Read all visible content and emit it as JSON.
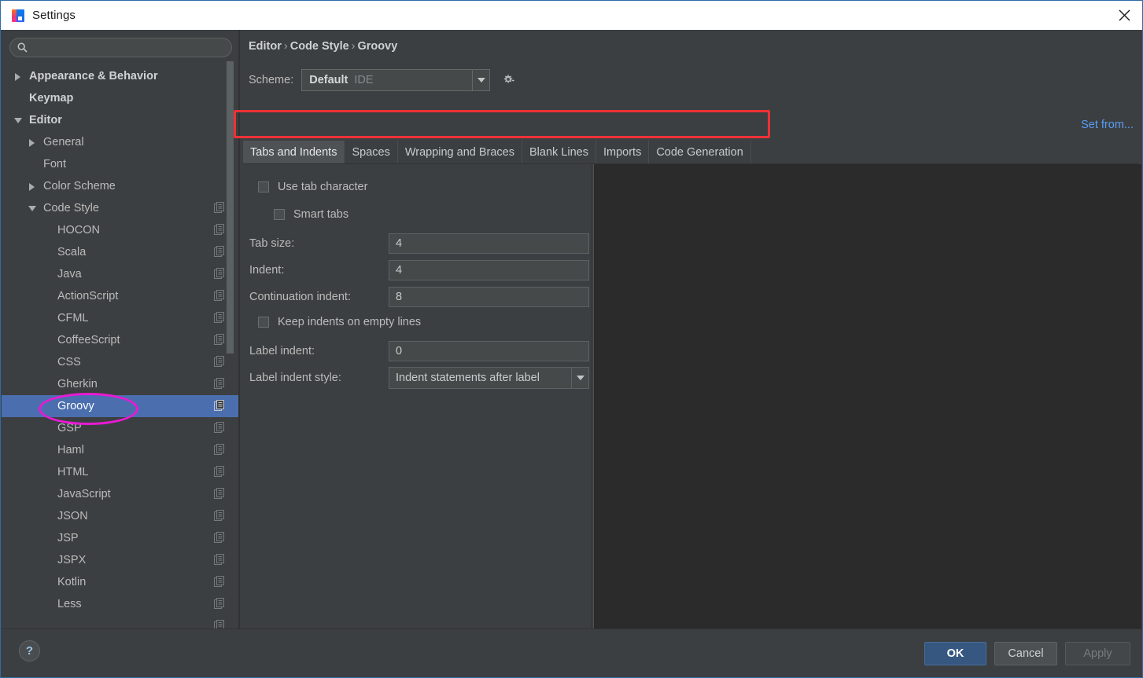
{
  "window": {
    "title": "Settings",
    "app_icon": "intellij-idea-icon",
    "close_icon": "close-icon"
  },
  "colors": {
    "accent_blue": "#4b6eaf",
    "link_blue": "#589df6",
    "primary_button": "#365880",
    "panel_bg": "#3c3f41",
    "preview_bg": "#2b2b2b",
    "annotation_red": "#ec3237",
    "annotation_magenta": "#e81ad4"
  },
  "sidebar": {
    "search": {
      "value": "",
      "placeholder": "",
      "icon": "search-icon"
    },
    "items": [
      {
        "label": "Appearance & Behavior",
        "indent": 0,
        "twisty": "collapsed",
        "bold": true,
        "selected": false,
        "copy_icon": false
      },
      {
        "label": "Keymap",
        "indent": 0,
        "twisty": "none",
        "bold": true,
        "selected": false,
        "copy_icon": false
      },
      {
        "label": "Editor",
        "indent": 0,
        "twisty": "expanded",
        "bold": true,
        "selected": false,
        "copy_icon": false
      },
      {
        "label": "General",
        "indent": 1,
        "twisty": "collapsed",
        "bold": false,
        "selected": false,
        "copy_icon": false
      },
      {
        "label": "Font",
        "indent": 1,
        "twisty": "none",
        "bold": false,
        "selected": false,
        "copy_icon": false
      },
      {
        "label": "Color Scheme",
        "indent": 1,
        "twisty": "collapsed",
        "bold": false,
        "selected": false,
        "copy_icon": false
      },
      {
        "label": "Code Style",
        "indent": 1,
        "twisty": "expanded",
        "bold": false,
        "selected": false,
        "copy_icon": true
      },
      {
        "label": "HOCON",
        "indent": 2,
        "twisty": "none",
        "bold": false,
        "selected": false,
        "copy_icon": true
      },
      {
        "label": "Scala",
        "indent": 2,
        "twisty": "none",
        "bold": false,
        "selected": false,
        "copy_icon": true
      },
      {
        "label": "Java",
        "indent": 2,
        "twisty": "none",
        "bold": false,
        "selected": false,
        "copy_icon": true
      },
      {
        "label": "ActionScript",
        "indent": 2,
        "twisty": "none",
        "bold": false,
        "selected": false,
        "copy_icon": true
      },
      {
        "label": "CFML",
        "indent": 2,
        "twisty": "none",
        "bold": false,
        "selected": false,
        "copy_icon": true
      },
      {
        "label": "CoffeeScript",
        "indent": 2,
        "twisty": "none",
        "bold": false,
        "selected": false,
        "copy_icon": true
      },
      {
        "label": "CSS",
        "indent": 2,
        "twisty": "none",
        "bold": false,
        "selected": false,
        "copy_icon": true
      },
      {
        "label": "Gherkin",
        "indent": 2,
        "twisty": "none",
        "bold": false,
        "selected": false,
        "copy_icon": true
      },
      {
        "label": "Groovy",
        "indent": 2,
        "twisty": "none",
        "bold": false,
        "selected": true,
        "copy_icon": true
      },
      {
        "label": "GSP",
        "indent": 2,
        "twisty": "none",
        "bold": false,
        "selected": false,
        "copy_icon": true
      },
      {
        "label": "Haml",
        "indent": 2,
        "twisty": "none",
        "bold": false,
        "selected": false,
        "copy_icon": true
      },
      {
        "label": "HTML",
        "indent": 2,
        "twisty": "none",
        "bold": false,
        "selected": false,
        "copy_icon": true
      },
      {
        "label": "JavaScript",
        "indent": 2,
        "twisty": "none",
        "bold": false,
        "selected": false,
        "copy_icon": true
      },
      {
        "label": "JSON",
        "indent": 2,
        "twisty": "none",
        "bold": false,
        "selected": false,
        "copy_icon": true
      },
      {
        "label": "JSP",
        "indent": 2,
        "twisty": "none",
        "bold": false,
        "selected": false,
        "copy_icon": true
      },
      {
        "label": "JSPX",
        "indent": 2,
        "twisty": "none",
        "bold": false,
        "selected": false,
        "copy_icon": true
      },
      {
        "label": "Kotlin",
        "indent": 2,
        "twisty": "none",
        "bold": false,
        "selected": false,
        "copy_icon": true
      },
      {
        "label": "Less",
        "indent": 2,
        "twisty": "none",
        "bold": false,
        "selected": false,
        "copy_icon": true
      },
      {
        "label": "",
        "indent": 2,
        "twisty": "none",
        "bold": false,
        "selected": false,
        "copy_icon": true
      }
    ]
  },
  "main": {
    "breadcrumb": {
      "parts": [
        "Editor",
        "Code Style",
        "Groovy"
      ],
      "separator": "›"
    },
    "scheme": {
      "label": "Scheme:",
      "value": "Default",
      "sub_value": "IDE",
      "gear_icon": "gear-dropdown-icon",
      "arrow_icon": "chevron-down-icon"
    },
    "set_from_link": "Set from...",
    "tabs": [
      {
        "label": "Tabs and Indents",
        "active": true
      },
      {
        "label": "Spaces",
        "active": false
      },
      {
        "label": "Wrapping and Braces",
        "active": false
      },
      {
        "label": "Blank Lines",
        "active": false
      },
      {
        "label": "Imports",
        "active": false
      },
      {
        "label": "Code Generation",
        "active": false
      }
    ],
    "form": {
      "use_tab_character": {
        "label": "Use tab character",
        "checked": false
      },
      "smart_tabs": {
        "label": "Smart tabs",
        "checked": false
      },
      "tab_size": {
        "label": "Tab size:",
        "value": "4"
      },
      "indent": {
        "label": "Indent:",
        "value": "4"
      },
      "continuation_indent": {
        "label": "Continuation indent:",
        "value": "8"
      },
      "keep_indents_empty_lines": {
        "label": "Keep indents on empty lines",
        "checked": false
      },
      "label_indent": {
        "label": "Label indent:",
        "value": "0"
      },
      "label_indent_style": {
        "label": "Label indent style:",
        "value": "Indent statements after label"
      }
    }
  },
  "footer": {
    "help_label": "?",
    "ok_label": "OK",
    "cancel_label": "Cancel",
    "apply_label": "Apply"
  }
}
